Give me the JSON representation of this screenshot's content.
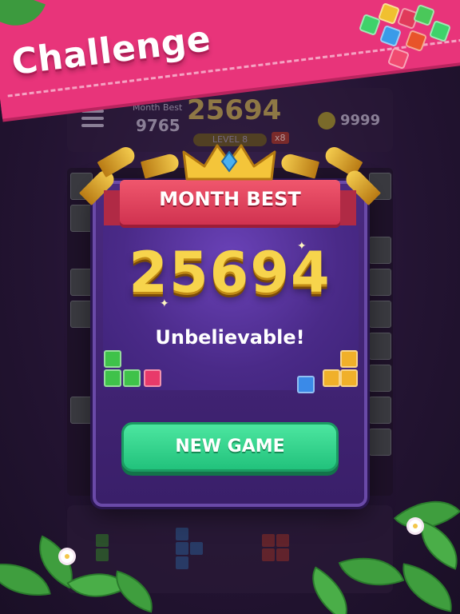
{
  "banner": {
    "title": "Challenge"
  },
  "hud": {
    "month_best_label": "Month Best",
    "month_best_value": "9765",
    "score": "25694",
    "level": "LEVEL 8",
    "multiplier": "x8",
    "coins": "9999"
  },
  "modal": {
    "ribbon_title": "MONTH BEST",
    "score": "25694",
    "subtitle": "Unbelievable!",
    "button_label": "NEW GAME"
  },
  "colors": {
    "banner": "#e8347a",
    "modal": "#4a2a80",
    "ribbon": "#e04561",
    "score_gold": "#f7d44c",
    "button_green": "#2fd88c"
  },
  "icons": [
    "menu-icon",
    "coin-icon",
    "crown-icon",
    "trumpet-icon",
    "gem-icon",
    "flower-icon",
    "leaf-icon"
  ]
}
